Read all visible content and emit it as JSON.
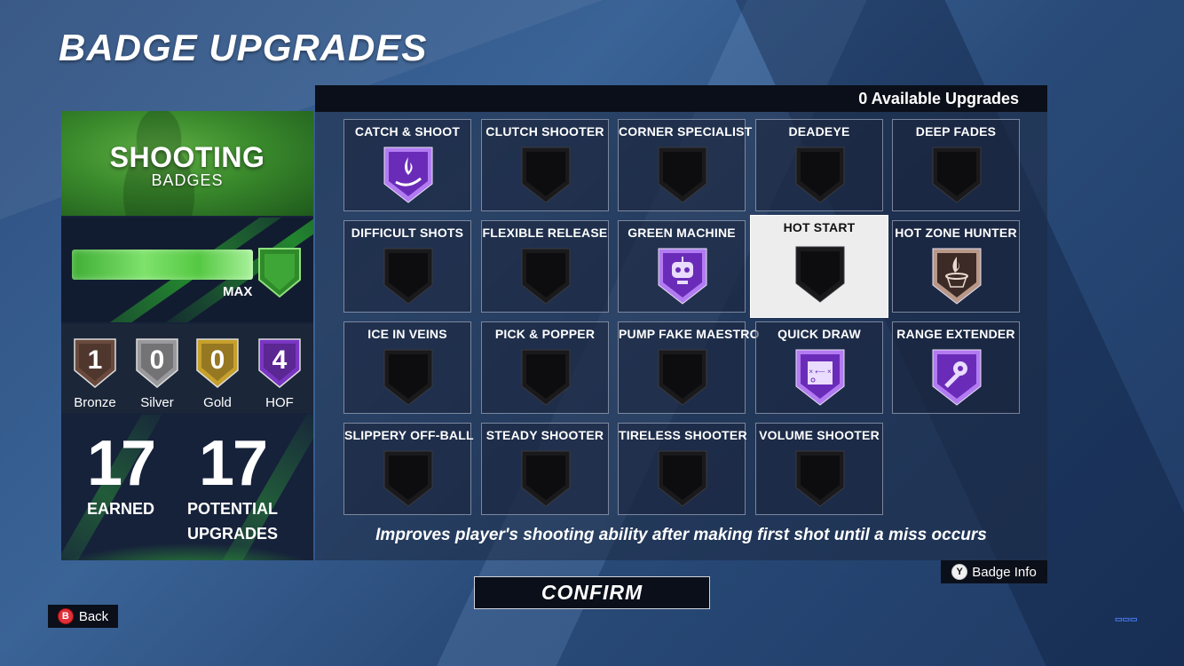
{
  "page_title": "BADGE UPGRADES",
  "category": {
    "title": "SHOOTING",
    "subtitle": "BADGES",
    "progress_fraction": 1.0,
    "progress_label": "MAX",
    "tiers": [
      {
        "count": "1",
        "label": "Bronze",
        "color": "#6b4a3e"
      },
      {
        "count": "0",
        "label": "Silver",
        "color": "#9a9a9e"
      },
      {
        "count": "0",
        "label": "Gold",
        "color": "#c7a02c"
      },
      {
        "count": "4",
        "label": "HOF",
        "color": "#7a35c4"
      }
    ],
    "earned_value": "17",
    "earned_label": "EARNED",
    "potential_value": "17",
    "potential_label_line1": "POTENTIAL",
    "potential_label_line2": "UPGRADES"
  },
  "grid": {
    "available_upgrades": "0 Available Upgrades",
    "badges": [
      {
        "name": "CATCH & SHOOT",
        "tier": "hof",
        "icon": "hand-flame-icon"
      },
      {
        "name": "CLUTCH SHOOTER",
        "tier": "none",
        "icon": "empty-shield-icon"
      },
      {
        "name": "CORNER SPECIALIST",
        "tier": "none",
        "icon": "empty-shield-icon"
      },
      {
        "name": "DEADEYE",
        "tier": "none",
        "icon": "empty-shield-icon"
      },
      {
        "name": "DEEP FADES",
        "tier": "none",
        "icon": "empty-shield-icon"
      },
      {
        "name": "DIFFICULT SHOTS",
        "tier": "none",
        "icon": "empty-shield-icon"
      },
      {
        "name": "FLEXIBLE RELEASE",
        "tier": "none",
        "icon": "empty-shield-icon"
      },
      {
        "name": "GREEN MACHINE",
        "tier": "hof",
        "icon": "robot-icon"
      },
      {
        "name": "HOT START",
        "tier": "none",
        "icon": "empty-shield-icon",
        "selected": true
      },
      {
        "name": "HOT ZONE HUNTER",
        "tier": "bronze",
        "icon": "flaming-hoop-icon"
      },
      {
        "name": "ICE IN VEINS",
        "tier": "none",
        "icon": "empty-shield-icon"
      },
      {
        "name": "PICK & POPPER",
        "tier": "none",
        "icon": "empty-shield-icon"
      },
      {
        "name": "PUMP FAKE MAESTRO",
        "tier": "none",
        "icon": "empty-shield-icon"
      },
      {
        "name": "QUICK DRAW",
        "tier": "hof",
        "icon": "playbook-icon"
      },
      {
        "name": "RANGE EXTENDER",
        "tier": "hof",
        "icon": "tape-measure-icon"
      },
      {
        "name": "SLIPPERY OFF-BALL",
        "tier": "none",
        "icon": "empty-shield-icon"
      },
      {
        "name": "STEADY SHOOTER",
        "tier": "none",
        "icon": "empty-shield-icon"
      },
      {
        "name": "TIRELESS SHOOTER",
        "tier": "none",
        "icon": "empty-shield-icon"
      },
      {
        "name": "VOLUME SHOOTER",
        "tier": "none",
        "icon": "empty-shield-icon"
      }
    ],
    "description": "Improves player's shooting ability after making first shot until a miss occurs"
  },
  "buttons": {
    "badge_info_glyph": "Y",
    "badge_info_label": "Badge Info",
    "confirm_label": "CONFIRM",
    "back_glyph": "B",
    "back_label": "Back"
  },
  "colors": {
    "hof_purple": "#8a3fd6",
    "bronze": "#6b4a3e",
    "shield_black": "#0d0d0f",
    "max_green": "#3fae35"
  }
}
